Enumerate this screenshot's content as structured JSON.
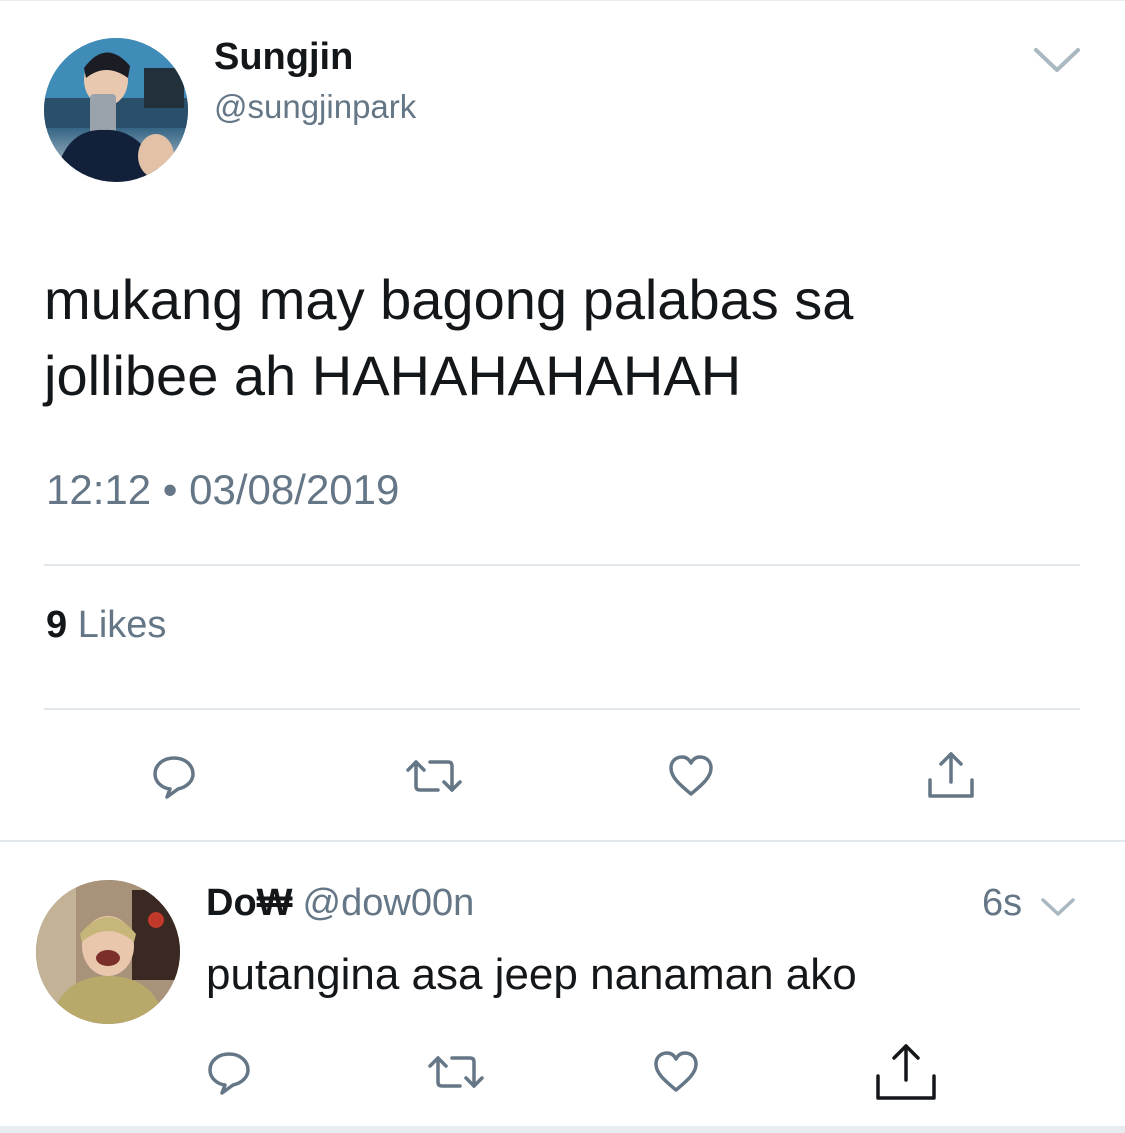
{
  "tweet": {
    "author_name": "Sungjin",
    "author_handle": "@sungjinpark",
    "text_line1": "mukang may bagong palabas sa",
    "text_line2": "jollibee ah HAHAHAHAHAH",
    "time": "12:12",
    "date": "03/08/2019",
    "separator": "•",
    "likes_count": "9",
    "likes_label": "Likes",
    "icons": [
      "reply-icon",
      "retweet-icon",
      "like-icon",
      "share-icon"
    ]
  },
  "reply": {
    "author_name": "Do₩",
    "author_handle": "@dow00n",
    "time": "6s",
    "text": "putangina asa jeep nanaman ako",
    "icons": [
      "reply-icon",
      "retweet-icon",
      "like-icon",
      "share-icon"
    ]
  },
  "colors": {
    "text_primary": "#14171a",
    "text_secondary": "#657786",
    "divider": "#e1e8ed",
    "icon": "#657786"
  }
}
